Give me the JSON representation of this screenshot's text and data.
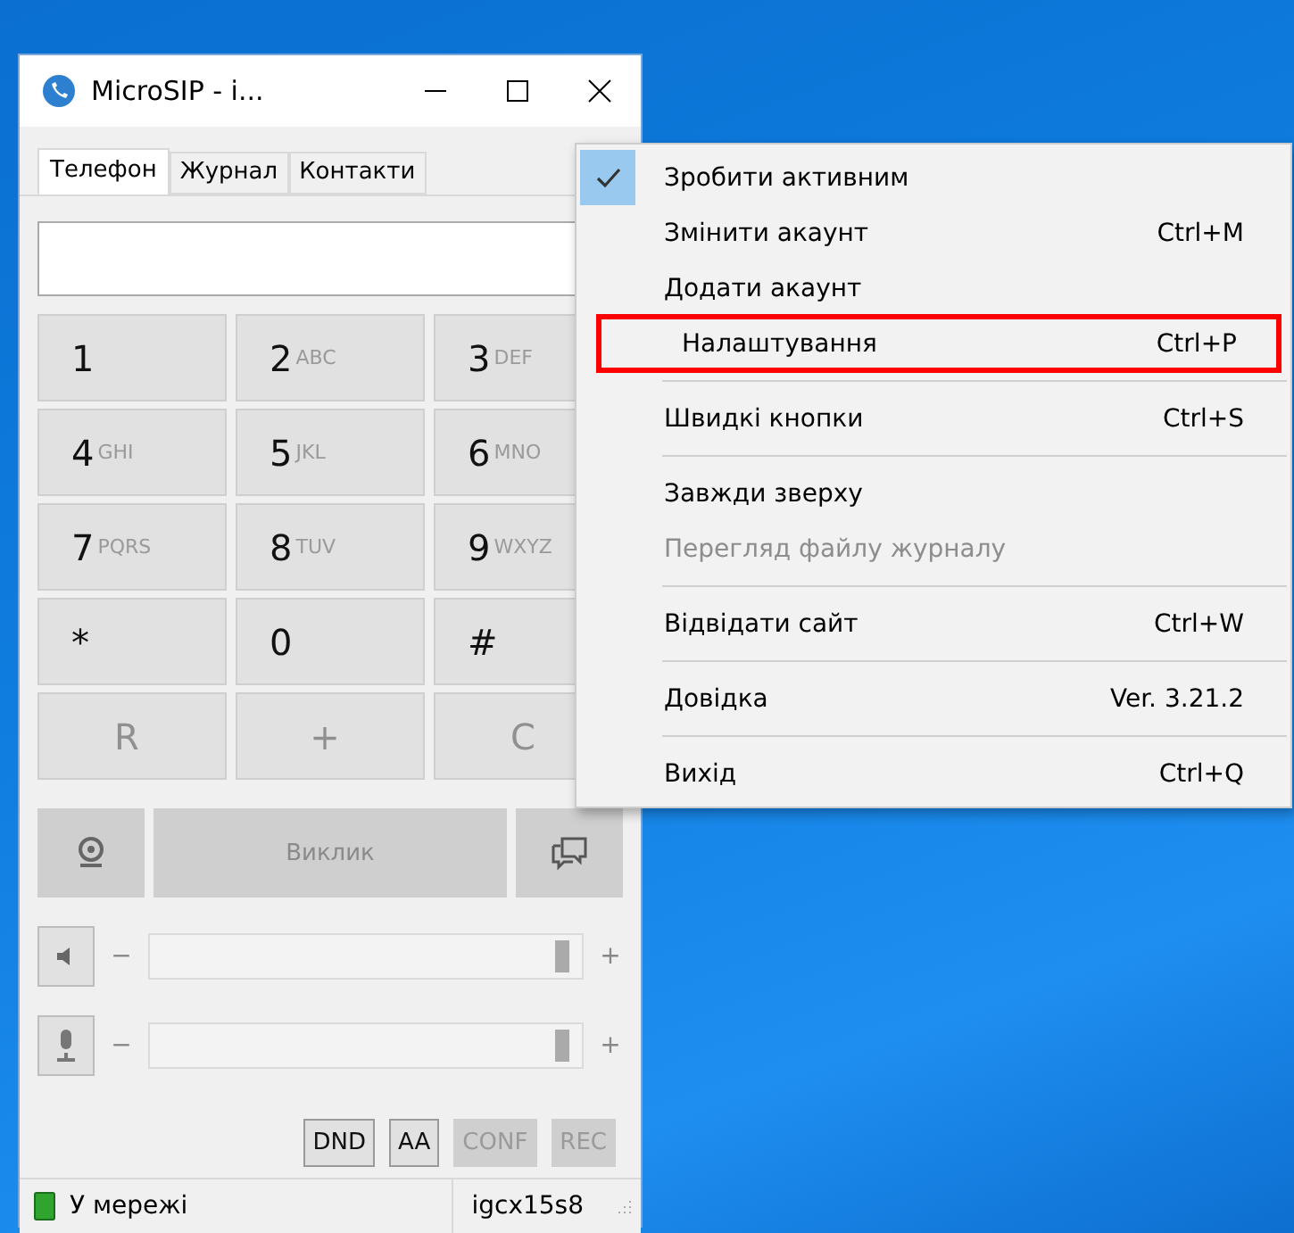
{
  "window": {
    "title": "MicroSIP - i..."
  },
  "tabs": [
    {
      "label": "Телефон",
      "selected": true
    },
    {
      "label": "Журнал",
      "selected": false
    },
    {
      "label": "Контакти",
      "selected": false
    }
  ],
  "keypad": [
    {
      "digit": "1",
      "disabled": false
    },
    {
      "digit": "2",
      "letters": "ABC",
      "disabled": false
    },
    {
      "digit": "3",
      "letters": "DEF",
      "disabled": false
    },
    {
      "digit": "4",
      "letters": "GHI",
      "disabled": false
    },
    {
      "digit": "5",
      "letters": "JKL",
      "disabled": false
    },
    {
      "digit": "6",
      "letters": "MNO",
      "disabled": false
    },
    {
      "digit": "7",
      "letters": "PQRS",
      "disabled": false
    },
    {
      "digit": "8",
      "letters": "TUV",
      "disabled": false
    },
    {
      "digit": "9",
      "letters": "WXYZ",
      "disabled": false
    },
    {
      "digit": "*",
      "disabled": false
    },
    {
      "digit": "0",
      "disabled": false
    },
    {
      "digit": "#",
      "disabled": false
    },
    {
      "digit": "R",
      "disabled": true
    },
    {
      "digit": "+",
      "disabled": true
    },
    {
      "digit": "C",
      "disabled": true
    }
  ],
  "call_button": {
    "label": "Виклик",
    "disabled": true
  },
  "sliders": [
    {
      "kind": "speaker",
      "minus": "−",
      "plus": "+",
      "level": 0.97
    },
    {
      "kind": "microphone",
      "minus": "−",
      "plus": "+",
      "level": 0.97
    }
  ],
  "toggles": [
    {
      "label": "DND",
      "disabled": false
    },
    {
      "label": "AA",
      "disabled": false
    },
    {
      "label": "CONF",
      "disabled": true
    },
    {
      "label": "REC",
      "disabled": true
    }
  ],
  "status_bar": {
    "status": "У мережі",
    "account": "igcx15s8"
  },
  "menu": [
    {
      "label": "Зробити активним",
      "checked": true,
      "disabled": false,
      "highlighted": false,
      "separator_after": false
    },
    {
      "label": "Змінити акаунт",
      "shortcut": "Ctrl+M",
      "checked": false,
      "disabled": false,
      "highlighted": false,
      "separator_after": false
    },
    {
      "label": "Додати акаунт",
      "checked": false,
      "disabled": false,
      "highlighted": false,
      "separator_after": false
    },
    {
      "label": "Налаштування",
      "shortcut": "Ctrl+P",
      "checked": false,
      "disabled": false,
      "highlighted": true,
      "separator_after": true
    },
    {
      "label": "Швидкі кнопки",
      "shortcut": "Ctrl+S",
      "checked": false,
      "disabled": false,
      "highlighted": false,
      "separator_after": true
    },
    {
      "label": "Завжди зверху",
      "checked": false,
      "disabled": false,
      "highlighted": false,
      "separator_after": false
    },
    {
      "label": "Перегляд файлу журналу",
      "checked": false,
      "disabled": true,
      "highlighted": false,
      "separator_after": true
    },
    {
      "label": "Відвідати сайт",
      "shortcut": "Ctrl+W",
      "checked": false,
      "disabled": false,
      "highlighted": false,
      "separator_after": true
    },
    {
      "label": "Довідка",
      "shortcut": "Ver. 3.21.2",
      "checked": false,
      "disabled": false,
      "highlighted": false,
      "separator_after": true
    },
    {
      "label": "Вихід",
      "shortcut": "Ctrl+Q",
      "checked": false,
      "disabled": false,
      "highlighted": false,
      "separator_after": false
    }
  ]
}
